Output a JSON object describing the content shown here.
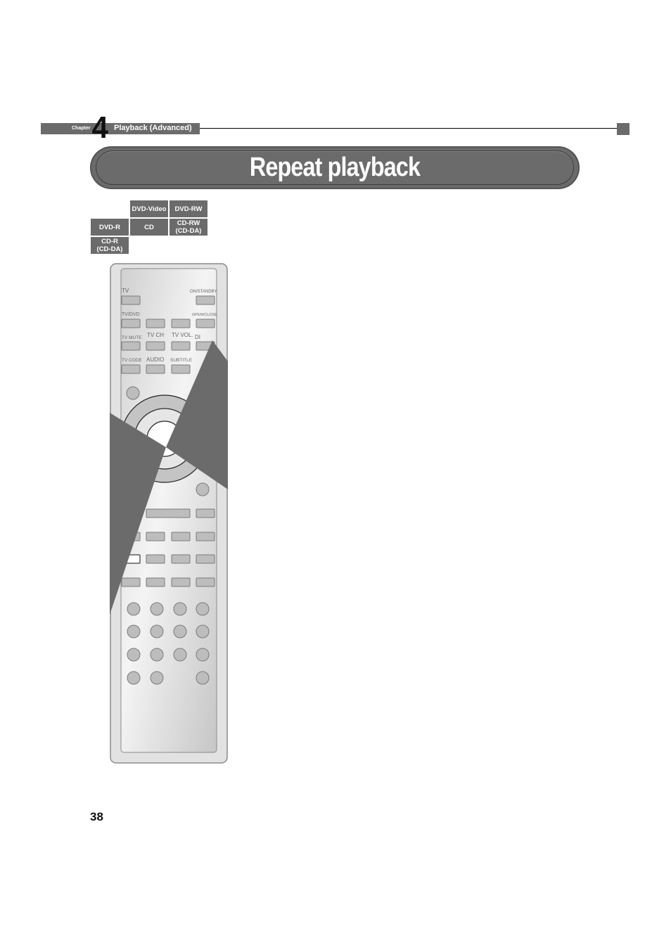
{
  "header": {
    "chapter_label": "Chapter",
    "chapter_number": "4",
    "chapter_title": "Playback (Advanced)"
  },
  "page_title": "Repeat playback",
  "disc_badges": [
    {
      "label": "DVD-Video"
    },
    {
      "label": "DVD-RW"
    },
    {
      "label": "DVD-R"
    },
    {
      "label": "CD"
    },
    {
      "label": "CD-RW\n(CD-DA)"
    },
    {
      "label": "CD-R\n(CD-DA)"
    }
  ],
  "remote": {
    "labels": {
      "tv": "TV",
      "on_standby": "ON/STANDBY",
      "tv_dvd": "TV/DVD",
      "open_close": "OPEN/CLOSE",
      "tv_mute": "TV MUTE",
      "tv_ch": "TV CH",
      "tv_vol": "TV VOL.",
      "display": "DI",
      "tv_code": "TV CODE",
      "audio": "AUDIO",
      "subtitle": "SUBTITLE"
    }
  },
  "page_number": "38",
  "colors": {
    "accent_gray": "#6b6b6b",
    "remote_body": "#d4d4d4",
    "button_fill": "#bdbdbd"
  }
}
